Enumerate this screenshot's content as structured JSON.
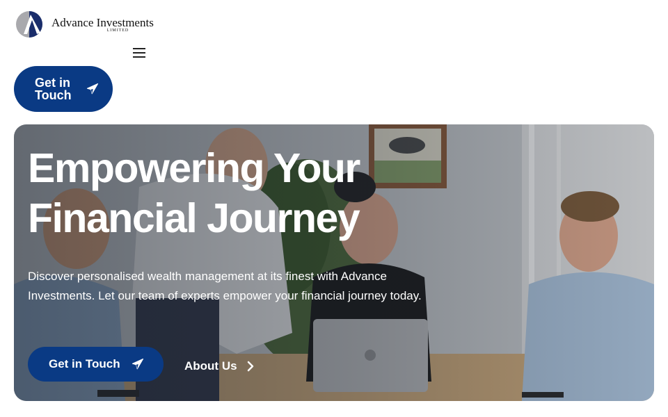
{
  "brand": {
    "name": "Advance Investments",
    "sub": "LIMITED"
  },
  "header": {
    "menu_icon": "hamburger-menu-icon",
    "cta_label": "Get in Touch",
    "cta_icon": "paper-plane-icon"
  },
  "hero": {
    "title": "Empowering Your Financial Journey",
    "subtitle": "Discover personalised wealth management at its finest with Advance Investments. Let our team of experts empower your financial journey today.",
    "primary_cta": "Get in Touch",
    "secondary_cta": "About Us",
    "secondary_icon": "chevron-right-icon"
  },
  "colors": {
    "primary": "#0a3a84",
    "white": "#ffffff",
    "text_dark": "#111111"
  }
}
